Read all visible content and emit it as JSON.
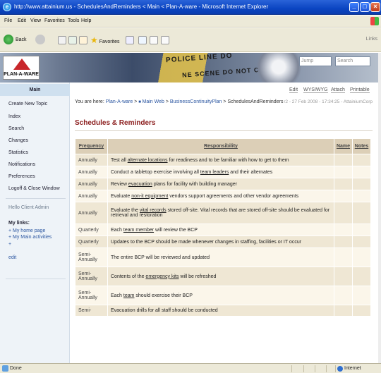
{
  "window": {
    "title": "http://www.attainium.us - SchedulesAndReminders < Main < Plan-A-ware - Microsoft Internet Explorer"
  },
  "menu": [
    "File",
    "Edit",
    "View",
    "Favorites",
    "Tools",
    "Help"
  ],
  "toolbar": {
    "back": "Back",
    "favorites": "Favorites",
    "links": "Links"
  },
  "banner": {
    "logo_text": "PLAN-A-WARE",
    "tape_line1": "POLICE LINE DO",
    "tape_line2": "NE SCENE DO NOT CROS",
    "jump_placeholder": "Jump",
    "search_placeholder": "Search"
  },
  "sidebar": {
    "header": "Main",
    "items": [
      "Create New Topic",
      "Index",
      "Search",
      "Changes",
      "Statistics",
      "Notifications",
      "Preferences",
      "Logoff & Close Window"
    ],
    "hello": "Hello Client Admin",
    "mylinks_title": "My links:",
    "mylinks": [
      "+ My home page",
      "+ My Main activities",
      "+",
      "edit"
    ]
  },
  "actions": [
    "Edit",
    "WYSIWYG",
    "Attach",
    "Printable"
  ],
  "breadcrumb": {
    "prefix": "You are here: ",
    "crumbs": [
      "Plan-A-ware",
      "Main Web",
      "BusinessContinuityPlan"
    ],
    "sep": " > ",
    "current": "SchedulesAndReminders"
  },
  "revision": "r2 - 27 Feb 2008 - 17:34:25 - AttainiumCorp",
  "page_title": "Schedules & Reminders",
  "table": {
    "headers": [
      "Frequency",
      "Responsibility",
      "Name",
      "Notes"
    ],
    "rows": [
      {
        "freq": "Annually",
        "pre": "Test all ",
        "link": "alternate locations",
        "post": " for readiness and to be familiar with how to get to them"
      },
      {
        "freq": "Annually",
        "pre": "Conduct a tabletop exercise involving all ",
        "link": "team leaders",
        "post": " and their alternates"
      },
      {
        "freq": "Annually",
        "pre": "Review ",
        "link": "evacuation",
        "post": " plans for facility with building manager"
      },
      {
        "freq": "Annually",
        "pre": "Evaluate ",
        "link": "non-it equipment",
        "post": " vendors support agreements and other vendor agreements"
      },
      {
        "freq": "Annually",
        "pre": "Evaluate the ",
        "link": "vital records",
        "post": " stored off-site. Vital records that are stored off-site should be evaluated for retrieval and restoration"
      },
      {
        "freq": "Quarterly",
        "pre": "Each ",
        "link": "team member",
        "post": " will review the BCP"
      },
      {
        "freq": "Quarterly",
        "pre": "Updates to the BCP should be made whenever changes in staffing, facilities or IT occur",
        "link": "",
        "post": ""
      },
      {
        "freq": "Semi-Annually",
        "pre": "The entire BCP will be reviewed and updated",
        "link": "",
        "post": ""
      },
      {
        "freq": "Semi-Annually",
        "pre": "Contents of the ",
        "link": "emergency kits",
        "post": " will be refreshed"
      },
      {
        "freq": "Semi-Annually",
        "pre": "Each ",
        "link": "team",
        "post": " should exercise their BCP"
      },
      {
        "freq": "Semi-",
        "pre": "Evacuation drills for all staff should be conducted",
        "link": "",
        "post": ""
      }
    ]
  },
  "status": {
    "done": "Done",
    "zone": "Internet"
  }
}
